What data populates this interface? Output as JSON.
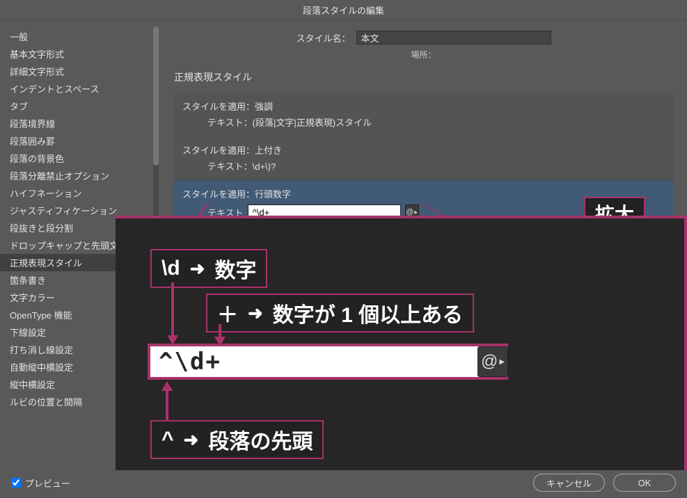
{
  "title": "段落スタイルの編集",
  "styleNameLabel": "スタイル名：",
  "styleNameValue": "本文",
  "locationLabel": "場所：",
  "sectionTitle": "正規表現スタイル",
  "sidebar": {
    "items": [
      "一般",
      "基本文字形式",
      "詳細文字形式",
      "インデントとスペース",
      "タブ",
      "段落境界線",
      "段落囲み罫",
      "段落の背景色",
      "段落分離禁止オプション",
      "ハイフネーション",
      "ジャスティフィケーション",
      "段抜きと段分割",
      "ドロップキャップと先頭文字",
      "正規表現スタイル",
      "箇条書き",
      "文字カラー",
      "OpenType 機能",
      "下線設定",
      "打ち消し線設定",
      "自動縦中横設定",
      "縦中横設定",
      "ルビの位置と間隔"
    ],
    "selectedIndex": 13
  },
  "rules": [
    {
      "applyLabel": "スタイルを適用：",
      "applyValue": "強調",
      "textLabel": "テキスト：",
      "textValue": "(段落|文字|正規表現)スタイル"
    },
    {
      "applyLabel": "スタイルを適用：",
      "applyValue": "上付き",
      "textLabel": "テキスト：",
      "textValue": "\\d+\\)?"
    },
    {
      "applyLabel": "スタイルを適用：",
      "applyValue": "行頭数字",
      "textLabel": "テキスト",
      "textValue": "^\\d+"
    }
  ],
  "enlargeLabel": "拡大",
  "preview": "プレビュー",
  "cancel": "キャンセル",
  "ok": "OK",
  "anno": {
    "d": "\\d",
    "dmeans": "数字",
    "plus": "＋",
    "plusmeans": "数字が 1 個以上ある",
    "caret": "^",
    "caretmeans": "段落の先頭",
    "bigInput": "^\\d+",
    "arrowGlyph": "➜",
    "at": "@"
  }
}
